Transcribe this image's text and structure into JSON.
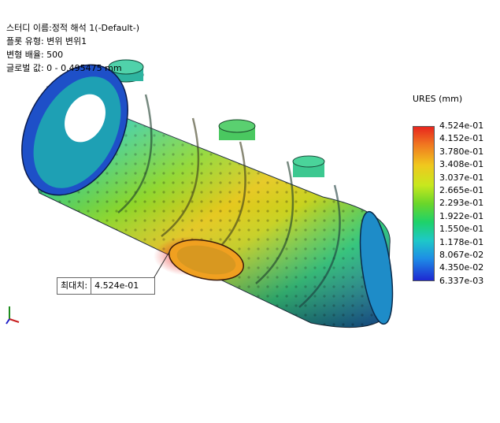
{
  "info": {
    "line1": "스터디 이름:정적 해석 1(-Default-)",
    "line2": "플롯 유형: 변위 변위1",
    "line3": "변형 배율: 500",
    "line4": "글로벌 값: 0 - 0.495475 mm"
  },
  "legend": {
    "title": "URES (mm)",
    "ticks": [
      "4.524e-01",
      "4.152e-01",
      "3.780e-01",
      "3.408e-01",
      "3.037e-01",
      "2.665e-01",
      "2.293e-01",
      "1.922e-01",
      "1.550e-01",
      "1.178e-01",
      "8.067e-02",
      "4.350e-02",
      "6.337e-03"
    ]
  },
  "annotation": {
    "label": "최대치:",
    "value": "4.524e-01"
  },
  "colors": {
    "max": "#e8261e",
    "min": "#1e28d2"
  }
}
